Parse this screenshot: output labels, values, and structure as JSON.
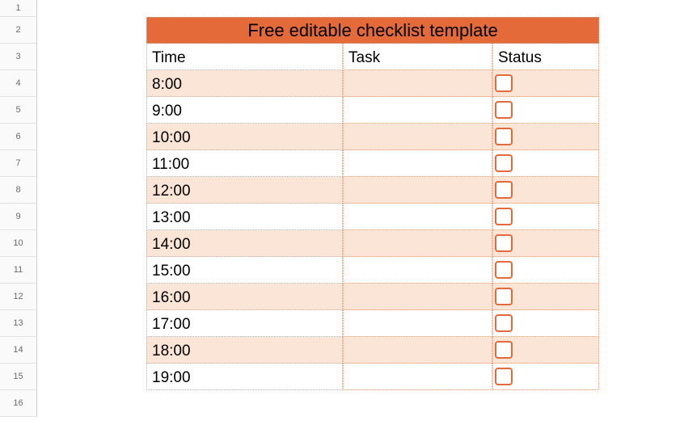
{
  "row_numbers": [
    "1",
    "2",
    "3",
    "4",
    "5",
    "6",
    "7",
    "8",
    "9",
    "10",
    "11",
    "12",
    "13",
    "14",
    "15",
    "16"
  ],
  "title": "Free editable checklist template",
  "columns": {
    "time": "Time",
    "task": "Task",
    "status": "Status"
  },
  "rows": [
    {
      "time": "8:00",
      "task": "",
      "checked": false
    },
    {
      "time": "9:00",
      "task": "",
      "checked": false
    },
    {
      "time": "10:00",
      "task": "",
      "checked": false
    },
    {
      "time": "11:00",
      "task": "",
      "checked": false
    },
    {
      "time": "12:00",
      "task": "",
      "checked": false
    },
    {
      "time": "13:00",
      "task": "",
      "checked": false
    },
    {
      "time": "14:00",
      "task": "",
      "checked": false
    },
    {
      "time": "15:00",
      "task": "",
      "checked": false
    },
    {
      "time": "16:00",
      "task": "",
      "checked": false
    },
    {
      "time": "17:00",
      "task": "",
      "checked": false
    },
    {
      "time": "18:00",
      "task": "",
      "checked": false
    },
    {
      "time": "19:00",
      "task": "",
      "checked": false
    }
  ]
}
